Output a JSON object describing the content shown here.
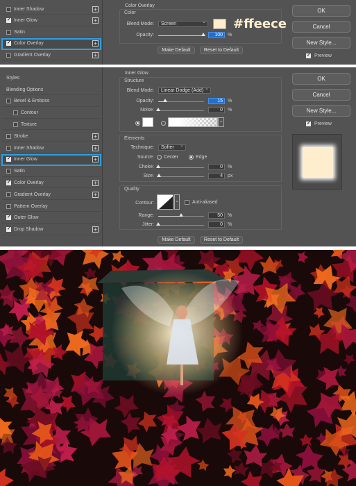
{
  "panel_top": {
    "styles": [
      {
        "label": "Inner Shadow",
        "checked": false,
        "plus": true
      },
      {
        "label": "Inner Glow",
        "checked": true,
        "plus": true
      },
      {
        "label": "Satin",
        "checked": false,
        "plus": false
      },
      {
        "label": "Color Overlay",
        "checked": true,
        "plus": true,
        "selected": true
      },
      {
        "label": "Gradient Overlay",
        "checked": false,
        "plus": true
      }
    ],
    "section_title": "Color Overlay",
    "group_title": "Color",
    "blend_mode_label": "Blend Mode:",
    "blend_mode_value": "Screen",
    "swatch_color": "#ffeece",
    "hex_annotation": "#ffeece",
    "opacity_label": "Opacity:",
    "opacity_value": "100",
    "opacity_unit": "%",
    "opacity_fraction": 1.0,
    "make_default": "Make Default",
    "reset_default": "Reset to Default",
    "ok": "OK",
    "cancel": "Cancel",
    "new_style": "New Style...",
    "preview": "Preview"
  },
  "panel_bottom": {
    "styles_header": "Styles",
    "styles": [
      {
        "label": "Blending Options",
        "checked": null,
        "plus": false
      },
      {
        "label": "Bevel & Emboss",
        "checked": false,
        "plus": false
      },
      {
        "label": "Contour",
        "checked": false,
        "plus": false,
        "indent": true
      },
      {
        "label": "Texture",
        "checked": false,
        "plus": false,
        "indent": true
      },
      {
        "label": "Stroke",
        "checked": false,
        "plus": true
      },
      {
        "label": "Inner Shadow",
        "checked": false,
        "plus": true
      },
      {
        "label": "Inner Glow",
        "checked": true,
        "plus": true,
        "selected": true
      },
      {
        "label": "Satin",
        "checked": false,
        "plus": false
      },
      {
        "label": "Color Overlay",
        "checked": true,
        "plus": true
      },
      {
        "label": "Gradient Overlay",
        "checked": false,
        "plus": true
      },
      {
        "label": "Pattern Overlay",
        "checked": false,
        "plus": false
      },
      {
        "label": "Outer Glow",
        "checked": true,
        "plus": false
      },
      {
        "label": "Drop Shadow",
        "checked": true,
        "plus": true
      }
    ],
    "section_title": "Inner Glow",
    "structure": {
      "title": "Structure",
      "blend_mode_label": "Blend Mode:",
      "blend_mode_value": "Linear Dodge (Add)",
      "opacity_label": "Opacity:",
      "opacity_value": "15",
      "opacity_fraction": 0.15,
      "noise_label": "Noise:",
      "noise_value": "0",
      "noise_fraction": 0,
      "unit": "%"
    },
    "elements": {
      "title": "Elements",
      "technique_label": "Technique:",
      "technique_value": "Softer",
      "source_label": "Source:",
      "source_center": "Center",
      "source_edge": "Edge",
      "choke_label": "Choke:",
      "choke_value": "0",
      "choke_fraction": 0,
      "size_label": "Size:",
      "size_value": "4",
      "size_fraction": 0.02,
      "pct": "%",
      "px": "px"
    },
    "quality": {
      "title": "Quality",
      "contour_label": "Contour:",
      "antialiased": "Anti-aliased",
      "range_label": "Range:",
      "range_value": "50",
      "range_fraction": 0.5,
      "jitter_label": "Jitter:",
      "jitter_value": "0",
      "jitter_fraction": 0,
      "unit": "%"
    },
    "make_default": "Make Default",
    "reset_default": "Reset to Default",
    "ok": "OK",
    "cancel": "Cancel",
    "new_style": "New Style...",
    "preview": "Preview"
  },
  "colors": {
    "panel_bg": "#535353",
    "selection_outline": "#2d9fe6",
    "highlight_field": "#1f6fd1",
    "overlay_swatch": "#ffeece"
  }
}
